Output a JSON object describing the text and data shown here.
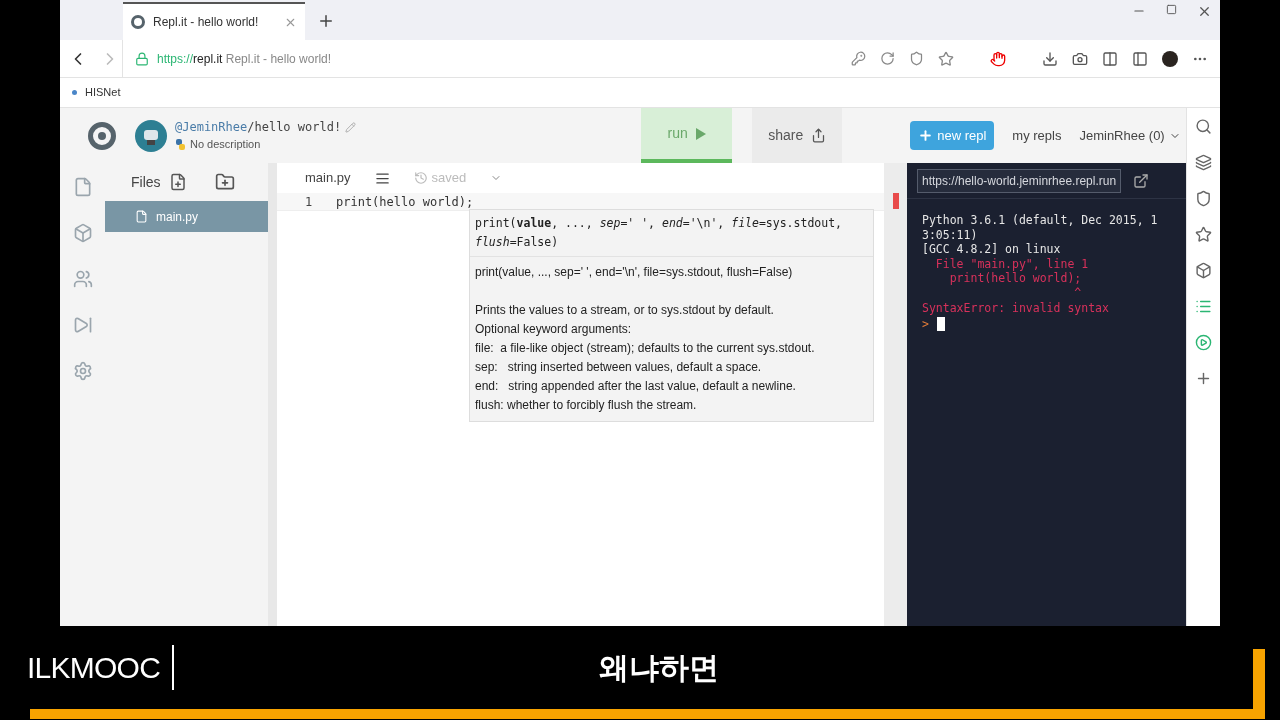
{
  "browser": {
    "tab": {
      "title": "Repl.it - hello world!",
      "selected": true
    },
    "url": {
      "scheme": "https://",
      "host": "repl.it",
      "page_title": "Repl.it - hello world!"
    },
    "bookmarks": [
      {
        "label": "HISNet"
      }
    ]
  },
  "header": {
    "owner": "@JeminRhee",
    "repl_name": "/hello world!",
    "description": "No description",
    "run_label": "run",
    "share_label": "share",
    "new_repl_label": "new repl",
    "my_repls_label": "my repls",
    "user_menu": "JeminRhee (0)"
  },
  "files": {
    "title": "Files",
    "items": [
      {
        "name": "main.py",
        "selected": true
      }
    ]
  },
  "editor": {
    "tab": "main.py",
    "status": "saved",
    "lines": [
      {
        "number": "1",
        "code": "print(hello world);"
      }
    ],
    "tooltip": {
      "signature": "print(**value**, ..., *sep*=' ', *end*='\\n', *file*=sys.stdout, *flush*=False)",
      "doc_signature": "print(value, ..., sep=' ', end='\\n', file=sys.stdout, flush=False)",
      "doc": [
        "Prints the values to a stream, or to sys.stdout by default.",
        "Optional keyword arguments:",
        "file:  a file-like object (stream); defaults to the current sys.stdout.",
        "sep:   string inserted between values, default a space.",
        "end:   string appended after the last value, default a newline.",
        "flush: whether to forcibly flush the stream."
      ]
    }
  },
  "console": {
    "url": "https://hello-world.jeminrhee.repl.run",
    "lines": [
      {
        "text": "Python 3.6.1 (default, Dec 2015, 1",
        "kind": "output"
      },
      {
        "text": "3:05:11)",
        "kind": "output"
      },
      {
        "text": "[GCC 4.8.2] on linux",
        "kind": "output"
      },
      {
        "text": "  File \"main.py\", line 1",
        "kind": "error"
      },
      {
        "text": "    print(hello world);",
        "kind": "error"
      },
      {
        "text": "                      ^",
        "kind": "error"
      },
      {
        "text": "SyntaxError: invalid syntax",
        "kind": "error"
      }
    ],
    "prompt": ">"
  },
  "video_overlay": {
    "logo": "ILKMOOC",
    "caption": "왜냐하면"
  }
}
